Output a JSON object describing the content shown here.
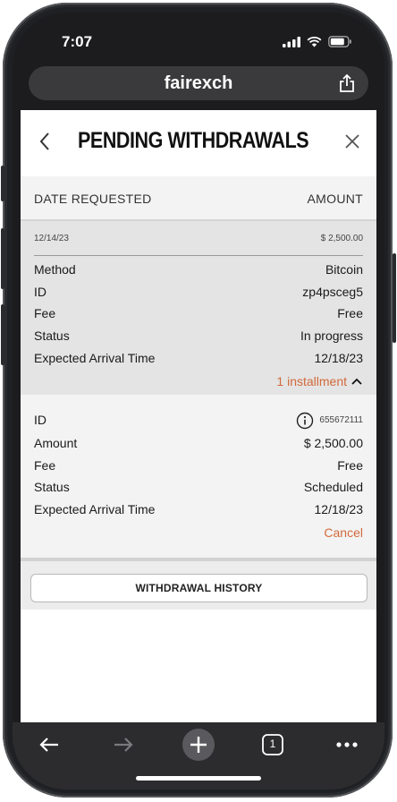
{
  "status_bar": {
    "time": "7:07"
  },
  "browser": {
    "url": "fairexch",
    "icons": [
      "share-icon"
    ]
  },
  "page": {
    "title": "PENDING WITHDRAWALS",
    "icons": [
      "back-chevron-icon",
      "close-icon"
    ]
  },
  "columns": {
    "date": "DATE REQUESTED",
    "amount": "AMOUNT"
  },
  "withdrawal": {
    "date": "12/14/23",
    "amount": "$ 2,500.00",
    "rows": [
      {
        "label": "Method",
        "value": "Bitcoin"
      },
      {
        "label": "ID",
        "value": "zp4psceg5"
      },
      {
        "label": "Fee",
        "value": "Free"
      },
      {
        "label": "Status",
        "value": "In progress"
      },
      {
        "label": "Expected Arrival Time",
        "value": "12/18/23"
      }
    ],
    "installments_toggle": "1 installment"
  },
  "installment": {
    "id_label": "ID",
    "id_value": "655672111",
    "rows": [
      {
        "label": "Amount",
        "value": "$ 2,500.00"
      },
      {
        "label": "Fee",
        "value": "Free"
      },
      {
        "label": "Status",
        "value": "Scheduled"
      },
      {
        "label": "Expected Arrival Time",
        "value": "12/18/23"
      }
    ],
    "cancel": "Cancel"
  },
  "history_button": "WITHDRAWAL HISTORY",
  "toolbar": {
    "icons": [
      "back-arrow-icon",
      "forward-arrow-icon",
      "new-tab-plus-icon",
      "tabs-count-icon",
      "more-icon"
    ],
    "tab_count": "1"
  },
  "colors": {
    "accent": "#d2693a",
    "toolbar": "#2c2c2e"
  }
}
